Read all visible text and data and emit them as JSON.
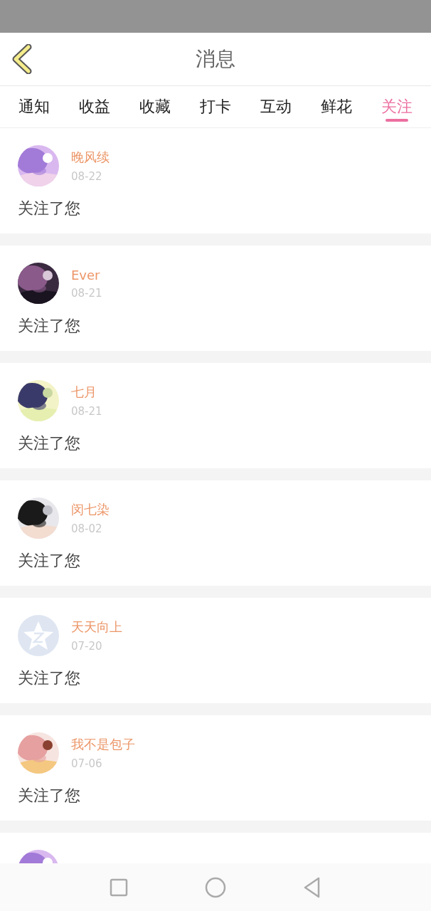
{
  "header": {
    "title": "消息"
  },
  "tabs": [
    {
      "label": "通知",
      "selected": false
    },
    {
      "label": "收益",
      "selected": false
    },
    {
      "label": "收藏",
      "selected": false
    },
    {
      "label": "打卡",
      "selected": false
    },
    {
      "label": "互动",
      "selected": false
    },
    {
      "label": "鲜花",
      "selected": false
    },
    {
      "label": "关注",
      "selected": true
    }
  ],
  "messages": [
    {
      "name": "晚风续",
      "date": "08-22",
      "text": "关注了您",
      "avatar": {
        "kind": "picture"
      }
    },
    {
      "name": "Ever",
      "date": "08-21",
      "text": "关注了您",
      "avatar": {
        "kind": "picture"
      }
    },
    {
      "name": "七月",
      "date": "08-21",
      "text": "关注了您",
      "avatar": {
        "kind": "picture"
      }
    },
    {
      "name": "闵七染",
      "date": "08-02",
      "text": "关注了您",
      "avatar": {
        "kind": "picture"
      }
    },
    {
      "name": "天天向上",
      "date": "07-20",
      "text": "关注了您",
      "avatar": {
        "kind": "default"
      }
    },
    {
      "name": "我不是包子",
      "date": "07-06",
      "text": "关注了您",
      "avatar": {
        "kind": "picture"
      }
    },
    {
      "avatar": {
        "kind": "picture"
      }
    }
  ]
}
